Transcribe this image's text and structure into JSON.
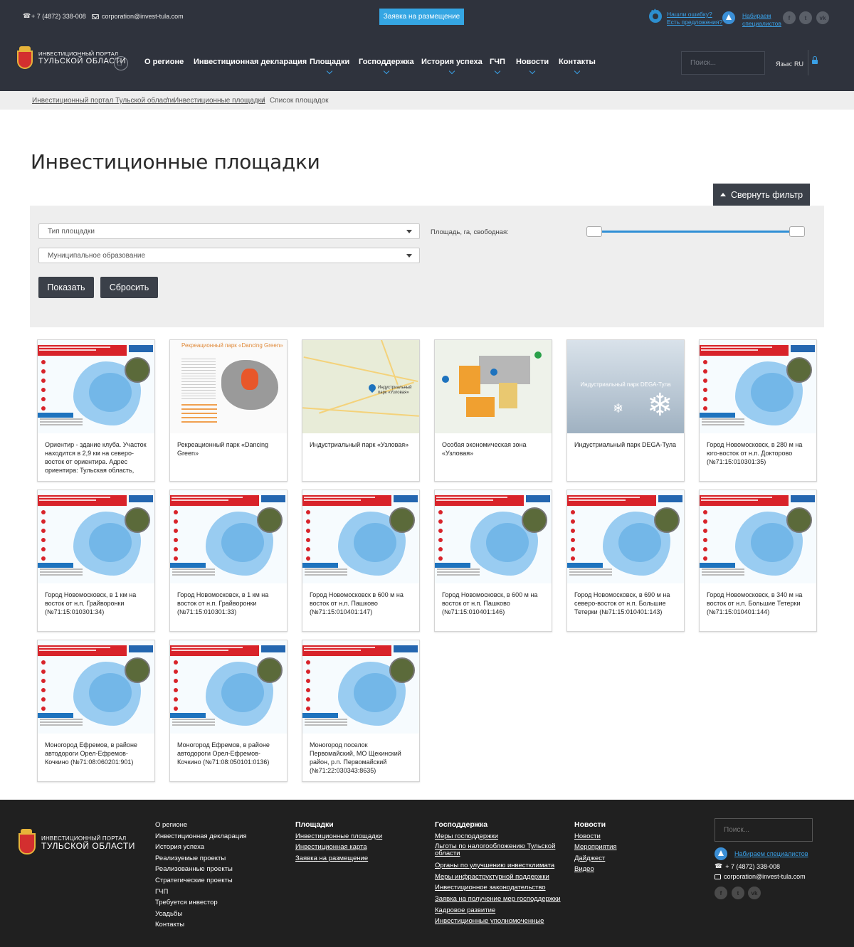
{
  "topbar": {
    "phone": "+ 7 (4872) 338-008",
    "email": "corporation@invest-tula.com",
    "apply_label": "Заявка на размещение",
    "error_link_l1": "Нашли ошибку?",
    "error_link_l2": "Есть предложения?",
    "specialists_l1": "Набираем",
    "specialists_l2": "специалистов",
    "socials": [
      "f",
      "t",
      "vk"
    ]
  },
  "header": {
    "logo_line1": "ИНВЕСТИЦИОННЫЙ ПОРТАЛ",
    "logo_line2": "ТУЛЬСКОЙ ОБЛАСТИ",
    "nav": [
      {
        "label": "О регионе",
        "has_submenu": false
      },
      {
        "label": "Инвестиционная декларация",
        "has_submenu": false
      },
      {
        "label": "Площадки",
        "has_submenu": true
      },
      {
        "label": "Господдержка",
        "has_submenu": true
      },
      {
        "label": "История успеха",
        "has_submenu": true
      },
      {
        "label": "ГЧП",
        "has_submenu": true
      },
      {
        "label": "Новости",
        "has_submenu": true
      },
      {
        "label": "Контакты",
        "has_submenu": true
      }
    ],
    "search_placeholder": "Поиск...",
    "language": "Язык: RU"
  },
  "breadcrumb": [
    {
      "label": "Инвестиционный портал Тульской области",
      "link": true
    },
    {
      "label": "Инвестиционные площадки",
      "link": true
    },
    {
      "label": "Список площадок",
      "link": false
    }
  ],
  "page_title": "Инвестиционные площадки",
  "collapse_filter_label": "Свернуть фильтр",
  "filter": {
    "type_placeholder": "Тип площадки",
    "municipality_placeholder": "Муниципальное образование",
    "area_label": "Площадь, га, свободная:",
    "area_range_fraction": [
      0,
      1
    ],
    "show_label": "Показать",
    "reset_label": "Сбросить"
  },
  "cards": [
    {
      "title": "Ориентир - здание клуба. Участок находится в 2,9 км на северо-восток от ориентира. Адрес ориентира: Тульская область,",
      "thumb": "map"
    },
    {
      "title": "Рекреационный парк «Dancing Green»",
      "thumb": "park"
    },
    {
      "title": "Индустриальный парк «Узловая»",
      "thumb": "gmap"
    },
    {
      "title": "Особая экономическая зона «Узловая»",
      "thumb": "zone"
    },
    {
      "title": "Индустриальный парк DEGA-Тула",
      "thumb": "snow"
    },
    {
      "title": "Город Новомосковск, в 280 м на юго-восток от н.п. Доктор­ово (№71:15:010301:35)",
      "thumb": "map"
    },
    {
      "title": "Город Новомосковск, в 1 км на восток от н.п. Грайворонки (№71:15:010301:34)",
      "thumb": "map"
    },
    {
      "title": "Город Новомосковск, в 1 км на восток от н.п. Грайворонки (№71:15:010301:33)",
      "thumb": "map"
    },
    {
      "title": "Город Новомосковск в 600 м на восток от н.п. Пашково (№71:15:010401:147)",
      "thumb": "map"
    },
    {
      "title": "Город Новомосковск, в 600 м на восток от н.п. Пашково (№71:15:010401:146)",
      "thumb": "map"
    },
    {
      "title": "Город Новомосковск, в 690 м на северо-восток от н.п. Большие Тетерки (№71:15:010401:143)",
      "thumb": "map"
    },
    {
      "title": "Город Новомосковск, в 340 м на восток от н.п. Большие Тетерки (№71:15:010401:144)",
      "thumb": "map"
    },
    {
      "title": "Моногород Ефремов, в районе автодороги Орел-Ефремов-Кочкино (№71:08:060201:901)",
      "thumb": "map"
    },
    {
      "title": "Моногород Ефремов, в районе автодороги Орел-Ефремов-Кочкино (№71:08:050101:0136)",
      "thumb": "map"
    },
    {
      "title": "Моногород поселок Первомайский, МО Щекинский район, р.п. Первомайский (№71:22:030343:8635)",
      "thumb": "map"
    }
  ],
  "thumbs": {
    "park_title": "Рекреационный парк «Dancing Green»",
    "gmap_label": "Индустриальный парк «Узловая»",
    "snow_label": "Индустриальный парк DEGA-Тула"
  },
  "footer": {
    "logo_line1": "ИНВЕСТИЦИОННЫЙ ПОРТАЛ",
    "logo_line2": "ТУЛЬСКОЙ ОБЛАСТИ",
    "col1": [
      "О регионе",
      "Инвестиционная декларация",
      "История успеха",
      "Реализуемые проекты",
      "Реализованные проекты",
      "Стратегические проекты",
      "ГЧП",
      "Требуется инвестор",
      "Усадьбы",
      "Контакты"
    ],
    "col2_head": "Площадки",
    "col2": [
      "Инвестиционные площадки",
      "Инвестиционная карта",
      "Заявка на размещение"
    ],
    "col3_head": "Господдержка",
    "col3": [
      "Меры господдержки",
      "Льготы по налогообложению Тульской области",
      "Органы по улучшению инвестклимата",
      "Меры инфраструктурной поддержки",
      "Инвестиционное законодательство",
      "Заявка на получение мер господдержки",
      "Кадровое развитие",
      "Инвестиционные уполномоченные"
    ],
    "col4_head": "Новости",
    "col4": [
      "Новости",
      "Мероприятия",
      "Дайджест",
      "Видео"
    ],
    "search_placeholder": "Поиск...",
    "specialists": "Набираем специалистов",
    "phone": "+ 7 (4872) 338-008",
    "email": "corporation@invest-tula.com",
    "socials": [
      "f",
      "t",
      "vk"
    ]
  }
}
